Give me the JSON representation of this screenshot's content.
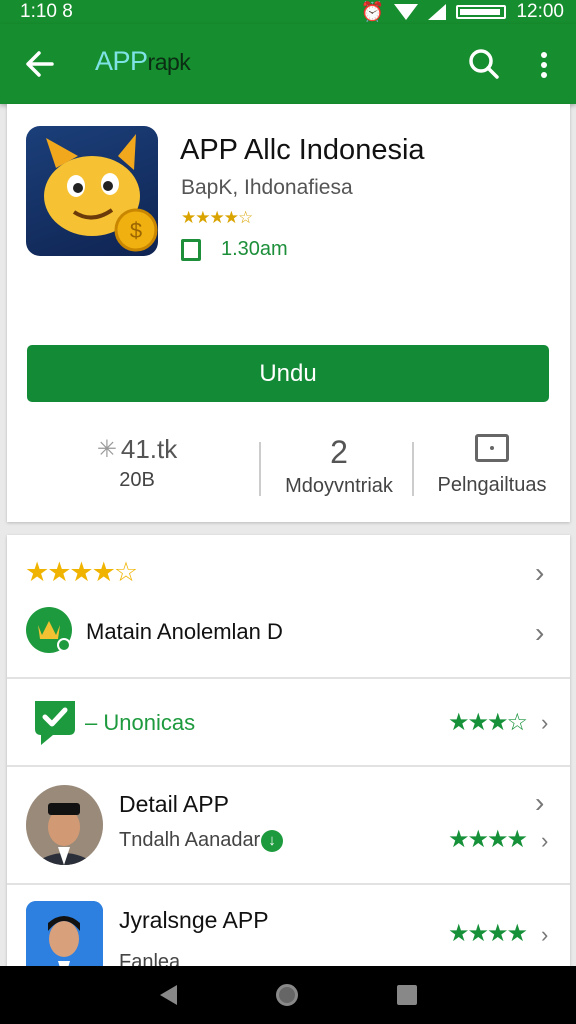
{
  "status_bar": {
    "time_left": "1:10 8",
    "time_right": "12:00"
  },
  "app_bar": {
    "title": "APP",
    "title_suffix": "rapk"
  },
  "app": {
    "name": "APP Allc Indonesia",
    "developer": "BapK, Ihdonafiesa",
    "stars": "★★★★☆",
    "size": "1.30am"
  },
  "install_label": "Undu",
  "stats": [
    {
      "value": "41.tk",
      "label": "20B"
    },
    {
      "value": "2",
      "label": "Mdoyvntriak"
    },
    {
      "value": "",
      "label": "Pelngailtuas"
    }
  ],
  "rating_row": {
    "stars": "★★★★☆"
  },
  "developer_row": {
    "label": "Matain Anolemlan D"
  },
  "verified_row": {
    "label": "– Unonicas",
    "stars": "★★★☆"
  },
  "reviews": [
    {
      "title": "Detail APP",
      "subtitle": "Tndalh Aanadar",
      "stars": "★★★★"
    },
    {
      "title": "Jyralsnge APP",
      "subtitle": "Fanlea",
      "stars": "★★★★"
    }
  ]
}
